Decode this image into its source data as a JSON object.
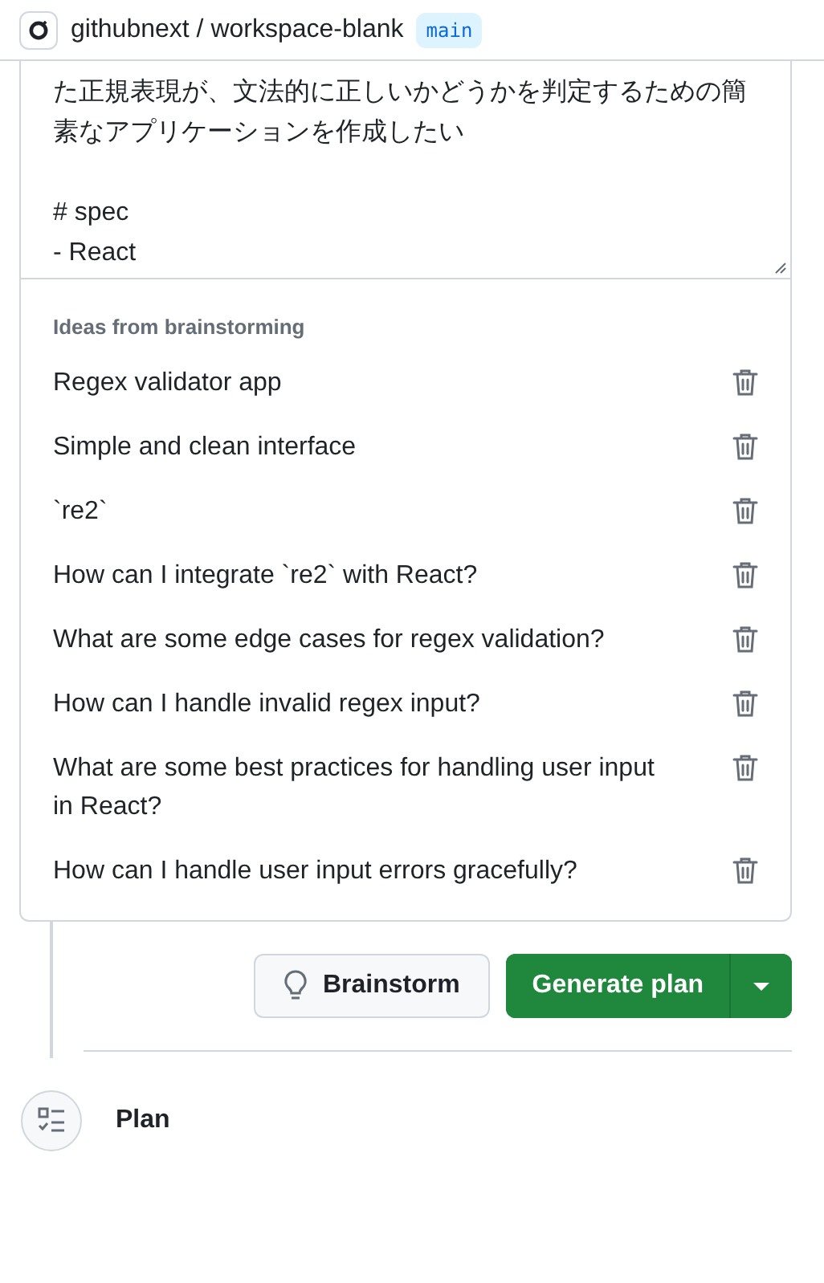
{
  "header": {
    "owner": "githubnext",
    "separator": "/",
    "repo": "workspace-blank",
    "branch": "main"
  },
  "task_text": "た正規表現が、文法的に正しいかどうかを判定するための簡素なアプリケーションを作成したい\n\n# spec\n- React",
  "ideas": {
    "heading": "Ideas from brainstorming",
    "items": [
      {
        "text": "Regex validator app"
      },
      {
        "text": "Simple and clean interface"
      },
      {
        "text": "`re2`"
      },
      {
        "text": "How can I integrate `re2` with React?"
      },
      {
        "text": "What are some edge cases for regex validation?"
      },
      {
        "text": "How can I handle invalid regex input?"
      },
      {
        "text": "What are some best practices for handling user input in React?"
      },
      {
        "text": "How can I handle user input errors gracefully?"
      }
    ]
  },
  "actions": {
    "brainstorm": "Brainstorm",
    "generate": "Generate plan"
  },
  "next_step": {
    "title": "Plan"
  }
}
